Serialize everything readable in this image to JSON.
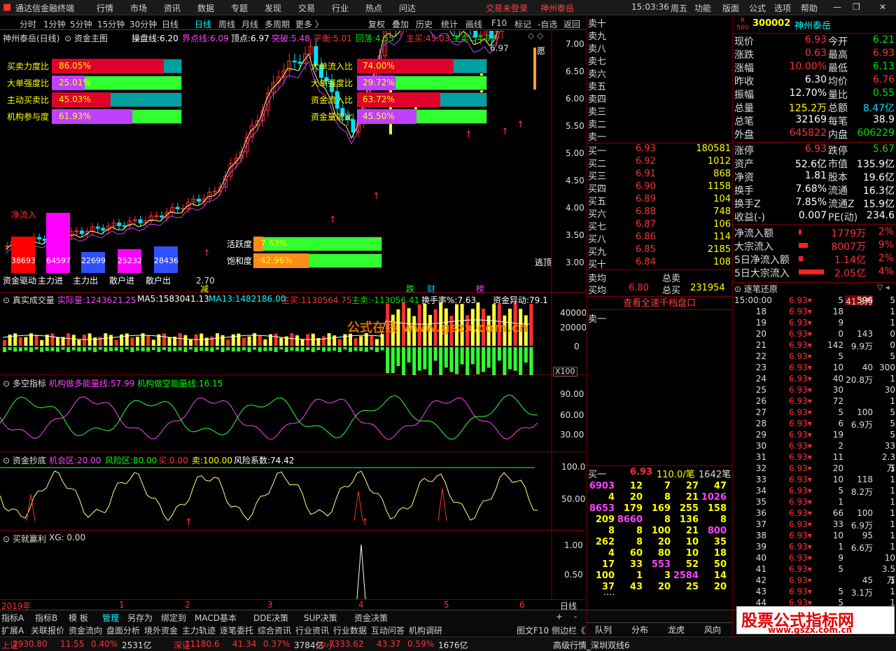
{
  "titlebar": {
    "app_name": "通达信金融终端",
    "menus": [
      "行情",
      "市场",
      "资讯",
      "数据",
      "专题",
      "发现",
      "交易",
      "行业",
      "热点",
      "问达"
    ],
    "login_status": "交易未登录",
    "stock_short": "神州泰岳",
    "time": "15:03:36",
    "weekday": "周五",
    "right_menus": [
      "功能",
      "版面",
      "公式",
      "选项",
      "帮助"
    ]
  },
  "tabbar": {
    "periods": [
      "分时",
      "1分钟",
      "5分钟",
      "15分钟",
      "30分钟",
      "日线",
      "周线",
      "月线",
      "多周期",
      "更多 〉"
    ],
    "tools": [
      "复权",
      "叠加",
      "历史",
      "统计",
      "画线",
      "F10",
      "标记",
      "-自选",
      "返回"
    ]
  },
  "main_chart": {
    "header_stock": "神州泰岳(日线)",
    "header_formula": "资金主图",
    "indicators": {
      "cpx_label": "操盘线:",
      "cpx_val": "6.20",
      "jdx_label": "界点线:",
      "jdx_val": "6.09",
      "dd_label": "顶点:",
      "dd_val": "6.97",
      "tp_label": "突破:",
      "tp_val": "5.48",
      "ph_label": "平衡:",
      "ph_val": "5.01",
      "hl_label": "回落:",
      "hl_val": "4.55",
      "zm_label": "主买:",
      "zm_val": "45.03",
      "zmai_label": "主卖:",
      "zmai_val": "54.97"
    },
    "left_ratios": [
      {
        "label": "买卖力度比",
        "value": "86.05%"
      },
      {
        "label": "大单强度比",
        "value": "25.01%"
      },
      {
        "label": "主动买卖比",
        "value": "45.03%"
      },
      {
        "label": "机构参与度",
        "value": "61.93%"
      }
    ],
    "right_ratios": [
      {
        "label": "大单流入比",
        "value": "74.00%"
      },
      {
        "label": "大单强度比",
        "value": "29.72%"
      },
      {
        "label": "资金流入比",
        "value": "63.72%"
      },
      {
        "label": "资金量能比",
        "value": "45.50%"
      }
    ],
    "net_inflow_label": "净流入",
    "funds_boxes": [
      {
        "label": "资金驱动",
        "value": "38693"
      },
      {
        "label": "主力进",
        "value": "64597"
      },
      {
        "label": "主力出",
        "value": "22699"
      },
      {
        "label": "散户进",
        "value": "25232"
      },
      {
        "label": "散户出",
        "value": "28436"
      }
    ],
    "activity": [
      {
        "label": "活跃度",
        "value": "7.63%"
      },
      {
        "label": "饱和度",
        "value": "42.96%"
      }
    ],
    "price_axis": [
      "7.00",
      "6.50",
      "6.00",
      "5.50",
      "5.00",
      "4.50",
      "4.00",
      "3.50",
      "3.00"
    ],
    "high_mark": "6.97",
    "low_mark": "2.70",
    "marks": [
      "减",
      "跌",
      "财",
      "榜"
    ],
    "yuan_label": "愿",
    "escape_label": "逃顶"
  },
  "volume_pane": {
    "title": "真实成交量",
    "actual_label": "实际量:",
    "actual_val": "1243621.25",
    "ma5_label": "MA5:",
    "ma5_val": "1583041.13",
    "ma13_label": "MA13:",
    "ma13_val": "1482186.00",
    "zm_label": "主买:",
    "zm_val": "1130564.75",
    "zmai_label": "主卖:",
    "zmai_val": "-113056.41",
    "hs_label": "换手率%:",
    "hs_val": "7.63",
    "zjyd_label": "资金异动:",
    "zjyd_val": "79.1",
    "axis": [
      "40000",
      "20000",
      "0"
    ],
    "unit": "X100",
    "watermark": "公式在线 www.gszx.com.cn"
  },
  "multi_pane": {
    "title": "多空指标",
    "l1_label": "机构做多能量线:",
    "l1_val": "57.99",
    "l2_label": "机构做空能量线:",
    "l2_val": "16.15",
    "axis": [
      "90.00",
      "60.00",
      "30.00"
    ]
  },
  "bottom_pane": {
    "title": "资金抄底",
    "a_label": "机会区:",
    "a_val": "20.00",
    "b_label": "风险区:",
    "b_val": "80.00",
    "c_label": "买:",
    "c_val": "0.00",
    "d_label": "卖:",
    "d_val": "100.00",
    "e_label": "风险系数:",
    "e_val": "74.42",
    "axis": [
      "100.0",
      "50.00"
    ]
  },
  "xg_pane": {
    "title": "买就赢利",
    "xg_label": "XG:",
    "xg_val": "0.00",
    "axis": [
      "1.00",
      "0.50"
    ]
  },
  "date_axis": {
    "year": "2019年",
    "months": [
      "1",
      "2",
      "3",
      "4",
      "5",
      "6"
    ],
    "period": "日线"
  },
  "bottom_tabs_row1": [
    "指标A",
    "指标B",
    "模 板",
    "管理",
    "另存为",
    "绑定到",
    "MACD基本",
    "DDE决策",
    "SUP决策",
    "资金决策"
  ],
  "bottom_tabs_row2": [
    "扩展A",
    "关联报价",
    "资金流向",
    "盘面分析",
    "境外资金",
    "主力轨迹",
    "逐笔委托",
    "综合资讯",
    "行业资讯",
    "行业数据",
    "互动问答",
    "机构调研"
  ],
  "bottom_right_tabs": [
    "图文F10",
    "侧边栏《"
  ],
  "order_book": {
    "sells": [
      "卖十",
      "卖九",
      "卖八",
      "卖七",
      "卖六",
      "卖五",
      "卖四",
      "卖三",
      "卖二",
      "卖一"
    ],
    "buys": [
      {
        "label": "买一",
        "price": "6.93",
        "vol": "180581"
      },
      {
        "label": "买二",
        "price": "6.92",
        "vol": "1012"
      },
      {
        "label": "买三",
        "price": "6.91",
        "vol": "868"
      },
      {
        "label": "买四",
        "price": "6.90",
        "vol": "1158"
      },
      {
        "label": "买五",
        "price": "6.89",
        "vol": "104"
      },
      {
        "label": "买六",
        "price": "6.88",
        "vol": "748"
      },
      {
        "label": "买七",
        "price": "6.87",
        "vol": "106"
      },
      {
        "label": "买八",
        "price": "6.86",
        "vol": "114"
      },
      {
        "label": "买九",
        "price": "6.85",
        "vol": "2185"
      },
      {
        "label": "买十",
        "price": "6.84",
        "vol": "108"
      }
    ],
    "avg_sell_label": "卖均",
    "total_sell_label": "总卖",
    "avg_buy_label": "买均",
    "avg_buy_val": "6.80",
    "total_buy_label": "总买",
    "total_buy_val": "231954",
    "view_btn": "查看全速千档盘口",
    "queue_sell_label": "卖一",
    "queue_buy_label": "买一",
    "queue_buy_price": "6.93",
    "queue_avg": "110.0/笔",
    "queue_count": "1642笔",
    "queue_rows": [
      [
        "6903",
        "12",
        "7",
        "27",
        "47"
      ],
      [
        "4",
        "20",
        "8",
        "21",
        "1026"
      ],
      [
        "8653",
        "179",
        "169",
        "255",
        "158"
      ],
      [
        "209",
        "8660",
        "8",
        "136",
        "8"
      ],
      [
        "8",
        "8",
        "100",
        "21",
        "800"
      ],
      [
        "262",
        "8",
        "20",
        "10",
        "35"
      ],
      [
        "4",
        "60",
        "80",
        "10",
        "18"
      ],
      [
        "17",
        "33",
        "553",
        "52",
        "50"
      ],
      [
        "100",
        "1",
        "3",
        "2584",
        "14"
      ],
      [
        "37",
        "43",
        "20",
        "25",
        "20"
      ]
    ],
    "queue_more": "....",
    "bottom_tabs": [
      "队列",
      "分布",
      "龙虎",
      "风向"
    ]
  },
  "quote": {
    "badge": "R 500",
    "code": "300002",
    "name": "神州泰岳",
    "rows": [
      [
        {
          "k": "现价",
          "v": "6.93",
          "c": "red"
        },
        {
          "k": "今开",
          "v": "6.21",
          "c": "grn"
        }
      ],
      [
        {
          "k": "涨跌",
          "v": "0.63",
          "c": "red"
        },
        {
          "k": "最高",
          "v": "6.93",
          "c": "red"
        }
      ],
      [
        {
          "k": "涨幅",
          "v": "10.00%",
          "c": "red"
        },
        {
          "k": "最低",
          "v": "6.13",
          "c": "grn"
        }
      ],
      [
        {
          "k": "昨收",
          "v": "6.30",
          "c": "wht"
        },
        {
          "k": "均价",
          "v": "6.76",
          "c": "red"
        }
      ],
      [
        {
          "k": "振幅",
          "v": "12.70%",
          "c": "wht"
        },
        {
          "k": "量比",
          "v": "0.55",
          "c": "grn"
        }
      ],
      [
        {
          "k": "总量",
          "v": "125.2万",
          "c": "yel"
        },
        {
          "k": "总额",
          "v": "8.47亿",
          "c": "cyan"
        }
      ],
      [
        {
          "k": "总笔",
          "v": "32169",
          "c": "wht"
        },
        {
          "k": "每笔",
          "v": "38.9",
          "c": "wht"
        }
      ],
      [
        {
          "k": "外盘",
          "v": "645822",
          "c": "red"
        },
        {
          "k": "内盘",
          "v": "606229",
          "c": "grn"
        }
      ]
    ],
    "rows2": [
      [
        {
          "k": "涨停",
          "v": "6.93",
          "c": "red"
        },
        {
          "k": "跌停",
          "v": "5.67",
          "c": "grn"
        }
      ],
      [
        {
          "k": "资产",
          "v": "52.6亿",
          "c": "wht"
        },
        {
          "k": "市值",
          "v": "135.9亿",
          "c": "wht"
        }
      ],
      [
        {
          "k": "净资",
          "v": "1.81",
          "c": "wht"
        },
        {
          "k": "股本",
          "v": "19.6亿",
          "c": "wht"
        }
      ],
      [
        {
          "k": "换手",
          "v": "7.68%",
          "c": "wht"
        },
        {
          "k": "流通",
          "v": "16.3亿",
          "c": "wht"
        }
      ],
      [
        {
          "k": "换手Z",
          "v": "7.85%",
          "c": "wht"
        },
        {
          "k": "流通Z",
          "v": "15.9亿",
          "c": "wht"
        }
      ],
      [
        {
          "k": "收益(-)",
          "v": "0.007",
          "c": "wht"
        },
        {
          "k": "PE(动)",
          "v": "234.6",
          "c": "wht"
        }
      ]
    ],
    "flows": [
      {
        "k": "净流入额",
        "v": "1779万",
        "p": "2%",
        "bar": 0.05
      },
      {
        "k": "大宗流入",
        "v": "8007万",
        "p": "9%",
        "bar": 0.3
      },
      {
        "k": "5日净流入额",
        "v": "1.14亿",
        "p": "2%",
        "bar": 0.1
      },
      {
        "k": "5日大宗流入",
        "v": "2.05亿",
        "p": "4%",
        "bar": 0.9
      }
    ]
  },
  "ticks": {
    "title": "逐笔还原",
    "first_time": "15:00:00",
    "rows": [
      {
        "t": "15:00:00",
        "p": "6.93",
        "v": "5",
        "box": "596",
        "box2": "41.3万",
        "side": "5"
      },
      {
        "t": "18",
        "p": "6.93",
        "v": "18",
        "side": "1"
      },
      {
        "t": "19",
        "p": "6.93",
        "v": "9",
        "side": "1"
      },
      {
        "t": "20",
        "p": "6.93",
        "v": "0",
        "box": "143",
        "side": "0"
      },
      {
        "t": "21",
        "p": "6.93",
        "v": "142",
        "box2": "9.9万",
        "side": "0"
      },
      {
        "t": "22",
        "p": "6.93",
        "v": "5",
        "side": "5"
      },
      {
        "t": "23",
        "p": "6.93",
        "v": "10",
        "box": "40",
        "side": "300"
      },
      {
        "t": "24",
        "p": "6.93",
        "v": "40",
        "box2": "20.8万",
        "side": "1"
      },
      {
        "t": "25",
        "p": "6.93",
        "v": "30",
        "side": "30"
      },
      {
        "t": "26",
        "p": "6.93",
        "v": "72",
        "side": "1"
      },
      {
        "t": "27",
        "p": "6.93",
        "v": "5",
        "box": "100",
        "side": "5"
      },
      {
        "t": "28",
        "p": "6.93",
        "v": "6",
        "box2": "6.9万",
        "side": "5"
      },
      {
        "t": "29",
        "p": "6.93",
        "v": "19",
        "side": "5"
      },
      {
        "t": "30",
        "p": "6.93",
        "v": "2",
        "side": "33"
      },
      {
        "t": "31",
        "p": "6.93",
        "v": "11",
        "side": "2.3万"
      },
      {
        "t": "32",
        "p": "6.93",
        "v": "20",
        "box": "",
        "side": "1"
      },
      {
        "t": "33",
        "p": "6.93",
        "v": "10",
        "box": "118",
        "side": "1"
      },
      {
        "t": "34",
        "p": "6.93",
        "v": "5",
        "box2": "8.2万",
        "side": "1"
      },
      {
        "t": "35",
        "p": "6.93",
        "v": "1",
        "side": "1"
      },
      {
        "t": "36",
        "p": "6.93",
        "v": "66",
        "box": "100",
        "side": "1"
      },
      {
        "t": "37",
        "p": "6.93",
        "v": "33",
        "box2": "6.9万",
        "side": "1"
      },
      {
        "t": "38",
        "p": "6.93",
        "v": "10",
        "box": "95",
        "side": "1"
      },
      {
        "t": "39",
        "p": "6.93",
        "v": "1",
        "box2": "6.6万",
        "side": "1"
      },
      {
        "t": "40",
        "p": "6.93",
        "v": "9",
        "side": "10"
      },
      {
        "t": "41",
        "p": "6.93",
        "v": "5",
        "side": "3.5万"
      },
      {
        "t": "42",
        "p": "6.93",
        "v": "",
        "box": "45",
        "side": "1"
      },
      {
        "t": "43",
        "p": "6.93",
        "v": "5",
        "box2": "3.1万",
        "side": "1"
      },
      {
        "t": "44",
        "p": "6.93",
        "v": "5",
        "side": "1"
      }
    ]
  },
  "watermark_brand": "股票公式指标网",
  "watermark_url": "www.gszx.com.cn",
  "status": [
    {
      "k": "上证",
      "v": "2930.80",
      "c": "11.55",
      "p": "0.40%",
      "a": "2531亿"
    },
    {
      "k": "深证",
      "v": "11180.6",
      "c": "41.34",
      "p": "0.37%",
      "a": "3784亿"
    },
    {
      "k": "中小",
      "v": "7333.62",
      "c": "43.37",
      "p": "0.59%",
      "a": "1676亿"
    }
  ],
  "status_right": "高级行情_深圳双线6"
}
